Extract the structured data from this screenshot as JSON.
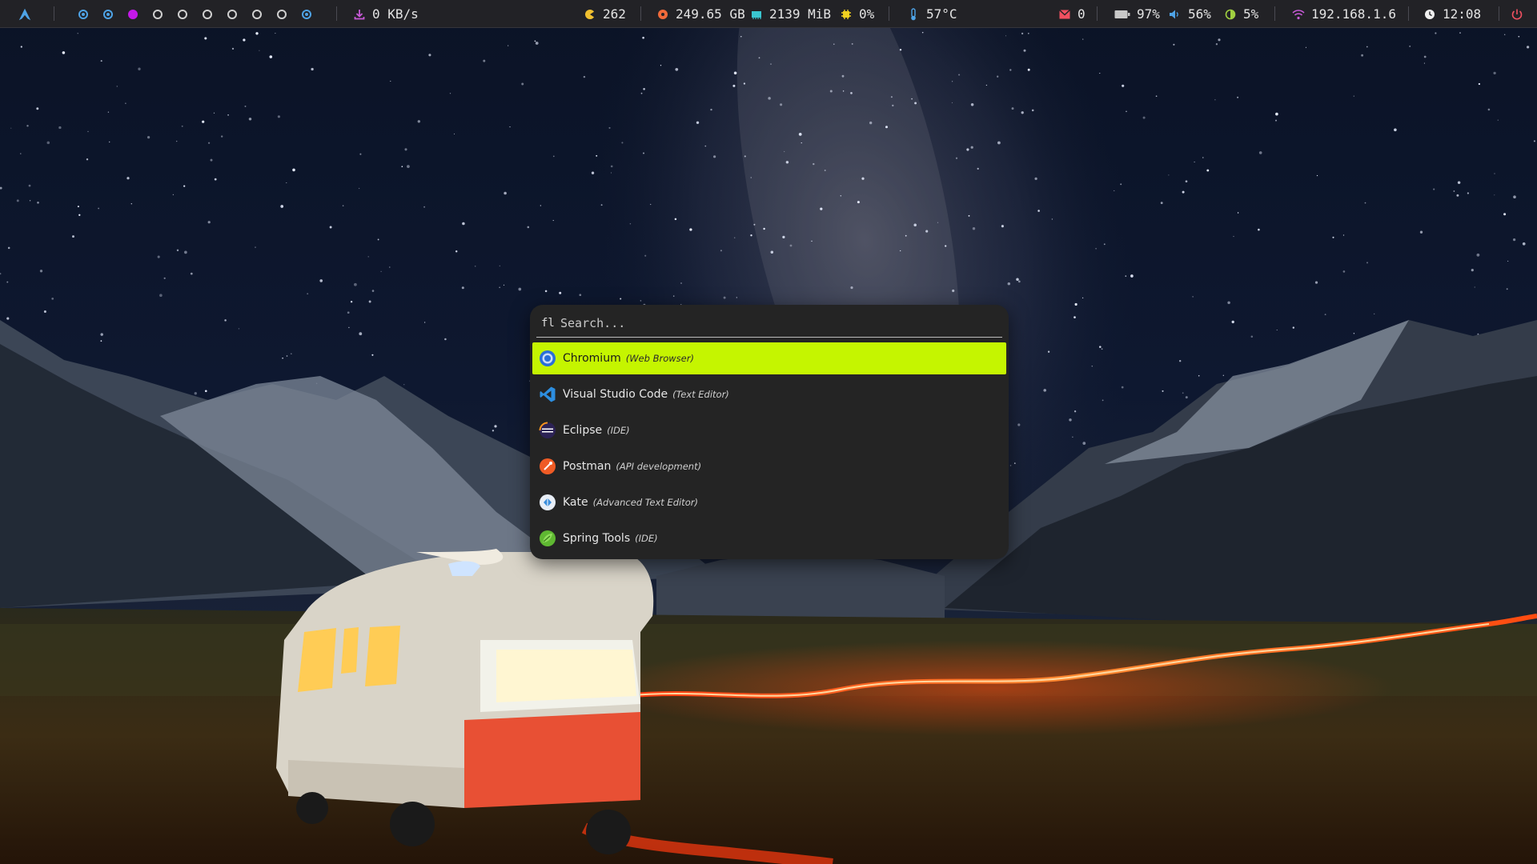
{
  "topbar": {
    "launcher_logo": "arch-logo-icon",
    "workspaces": [
      {
        "state": "occupied"
      },
      {
        "state": "occupied"
      },
      {
        "state": "active"
      },
      {
        "state": "empty"
      },
      {
        "state": "empty"
      },
      {
        "state": "empty"
      },
      {
        "state": "empty"
      },
      {
        "state": "empty"
      },
      {
        "state": "empty"
      },
      {
        "state": "occupied"
      }
    ],
    "network_speed": "0 KB/s",
    "updates": "262",
    "disk": "249.65 GB",
    "memory": "2139 MiB",
    "cpu": "0%",
    "temperature": "57°C",
    "mail": "0",
    "battery": "97%",
    "volume": "56%",
    "brightness": "5%",
    "ip": "192.168.1.6",
    "clock": "12:08",
    "colors": {
      "bar_bg": "#222226",
      "workspace_occupied": "#4ea3e6",
      "workspace_active": "#c418e8",
      "download": "#c85ad8",
      "updates": "#f0c030",
      "disk": "#f06a3a",
      "memory": "#3ac6d0",
      "cpu": "#f0d020",
      "temperature": "#4ea3e6",
      "mail": "#f05060",
      "battery": "#c8c8c8",
      "volume": "#4ea3e6",
      "brightness": "#a0d040",
      "wifi": "#c85ad8",
      "clock": "#f0f0f0",
      "power": "#f05060"
    }
  },
  "launcher": {
    "prompt_icon": "fl",
    "search_placeholder": "Search...",
    "accent": "#c5f500",
    "results": [
      {
        "name": "Chromium",
        "desc": "(Web Browser)",
        "icon": "chromium-icon",
        "selected": true
      },
      {
        "name": "Visual Studio Code",
        "desc": "(Text Editor)",
        "icon": "vscode-icon",
        "selected": false
      },
      {
        "name": "Eclipse",
        "desc": "(IDE)",
        "icon": "eclipse-icon",
        "selected": false
      },
      {
        "name": "Postman",
        "desc": "(API development)",
        "icon": "postman-icon",
        "selected": false
      },
      {
        "name": "Kate",
        "desc": "(Advanced Text Editor)",
        "icon": "kate-icon",
        "selected": false
      },
      {
        "name": "Spring Tools",
        "desc": "(IDE)",
        "icon": "spring-icon",
        "selected": false
      }
    ]
  }
}
